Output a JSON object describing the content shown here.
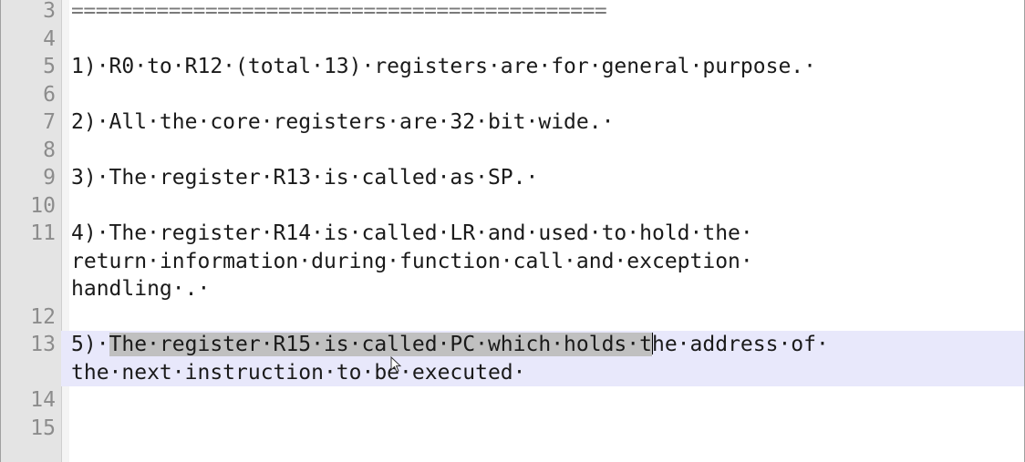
{
  "editor": {
    "lines": [
      {
        "num": "3",
        "text": "============================================"
      },
      {
        "num": "4",
        "text": ""
      },
      {
        "num": "5",
        "text": "1)·R0·to·R12·(total·13)·registers·are·for·general·purpose.·"
      },
      {
        "num": "6",
        "text": ""
      },
      {
        "num": "7",
        "text": "2)·All·the·core·registers·are·32·bit·wide.·"
      },
      {
        "num": "8",
        "text": ""
      },
      {
        "num": "9",
        "text": "3)·The·register·R13·is·called·as·SP.·"
      },
      {
        "num": "10",
        "text": ""
      },
      {
        "num": "11",
        "text": "4)·The·register·R14·is·called·LR·and·used·to·hold·the·\nreturn·information·during·function·call·and·exception·\nhandling·.·"
      },
      {
        "num": "12",
        "text": ""
      },
      {
        "num": "13",
        "prefix": "5)·",
        "selected": "The·register·R15·is·called·PC·which·holds·t",
        "suffix": "he·address·of·\nthe·next·instruction·to·be·executed·"
      },
      {
        "num": "14",
        "text": ""
      },
      {
        "num": "15",
        "text": ""
      }
    ]
  },
  "colors": {
    "gutter": "#e4e4e4",
    "current_line": "#e8e8fb",
    "selection": "#c0c0c0"
  },
  "cursor": "i-beam-cursor-icon"
}
